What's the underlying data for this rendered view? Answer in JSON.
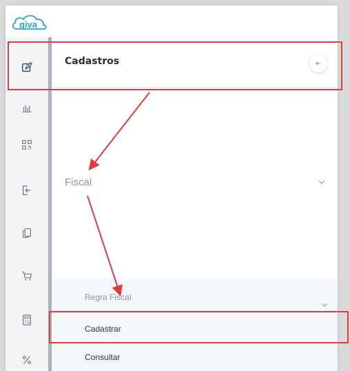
{
  "app": {
    "logo_text": "giva"
  },
  "rail": {
    "items": [
      {
        "icon": "edit-icon",
        "active": true
      },
      {
        "icon": "bar-chart-icon"
      },
      {
        "icon": "qr-code-icon"
      },
      {
        "icon": "login-icon"
      },
      {
        "icon": "documents-icon"
      },
      {
        "icon": "cart-icon"
      },
      {
        "icon": "calculator-icon"
      },
      {
        "icon": "percent-icon"
      }
    ]
  },
  "panel": {
    "title": "Cadastros",
    "back_icon": "arrow-left-icon",
    "sections": [
      {
        "label": "Fiscal",
        "expanded": true,
        "groups": [
          {
            "label": "Regra Fiscal",
            "expanded": true,
            "items": [
              {
                "label": "Cadastrar",
                "highlighted": true
              },
              {
                "label": "Consultar"
              }
            ]
          }
        ]
      }
    ]
  },
  "colors": {
    "annotation": "#e23b3b",
    "rail_bg": "#f3f4f5",
    "rail_divider": "#a9b3bd",
    "icon": "#6f7780",
    "icon_active": "#3a4d63",
    "brand": "#2a9fd6",
    "submenu_bg": "#f5f8fb"
  }
}
